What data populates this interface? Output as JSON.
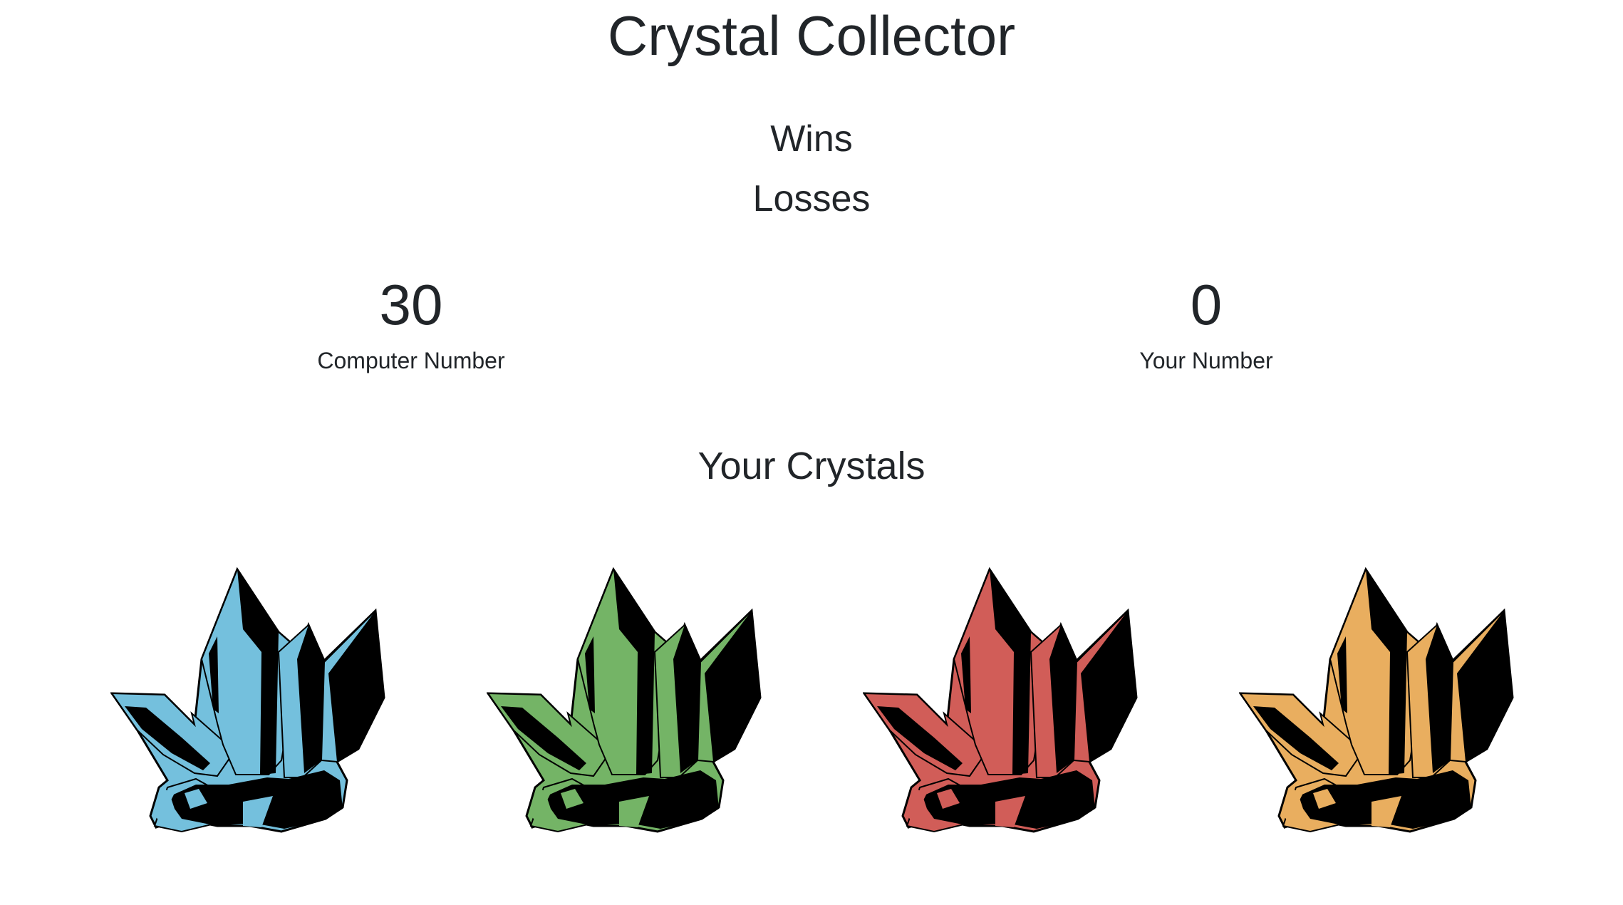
{
  "page": {
    "title": "Crystal Collector",
    "wins_label": "Wins",
    "losses_label": "Losses"
  },
  "scores": {
    "computer_number": "30",
    "computer_caption": "Computer Number",
    "your_number": "0",
    "your_caption": "Your Number"
  },
  "crystals": {
    "heading": "Your Crystals",
    "items": [
      {
        "name": "blue-crystal",
        "color": "#74c0dd"
      },
      {
        "name": "green-crystal",
        "color": "#74b466"
      },
      {
        "name": "red-crystal",
        "color": "#d15d58"
      },
      {
        "name": "orange-crystal",
        "color": "#e9ae5f"
      }
    ]
  }
}
